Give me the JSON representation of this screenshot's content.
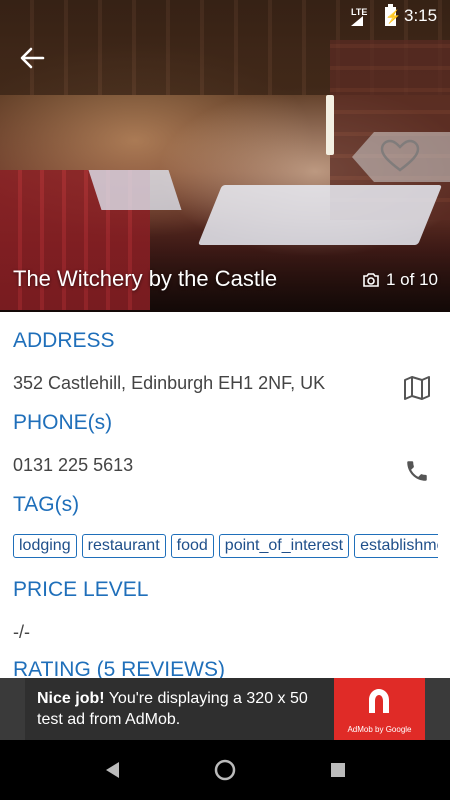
{
  "status_bar": {
    "network": "LTE",
    "time": "3:15"
  },
  "hero": {
    "title": "The Witchery by the Castle",
    "photo_count": "1 of 10"
  },
  "sections": {
    "address": {
      "label": "ADDRESS",
      "value": "352 Castlehill, Edinburgh EH1 2NF, UK"
    },
    "phone": {
      "label": "PHONE(s)",
      "value": "0131 225 5613"
    },
    "tags": {
      "label": "TAG(s)",
      "items": [
        "lodging",
        "restaurant",
        "food",
        "point_of_interest",
        "establishment"
      ]
    },
    "price": {
      "label": "PRICE LEVEL",
      "value": "-/-"
    },
    "rating": {
      "label": "RATING (5 REVIEWS)"
    }
  },
  "ad": {
    "headline": "Nice job!",
    "body": " You're displaying a 320 x 50 test ad from AdMob.",
    "brand": "AdMob by Google"
  },
  "colors": {
    "accent": "#1f6fba",
    "ad_red": "#e02b27"
  },
  "icons": [
    "back-arrow-icon",
    "heart-icon",
    "camera-icon",
    "map-icon",
    "phone-icon",
    "nav-back-icon",
    "nav-home-icon",
    "nav-recents-icon"
  ]
}
